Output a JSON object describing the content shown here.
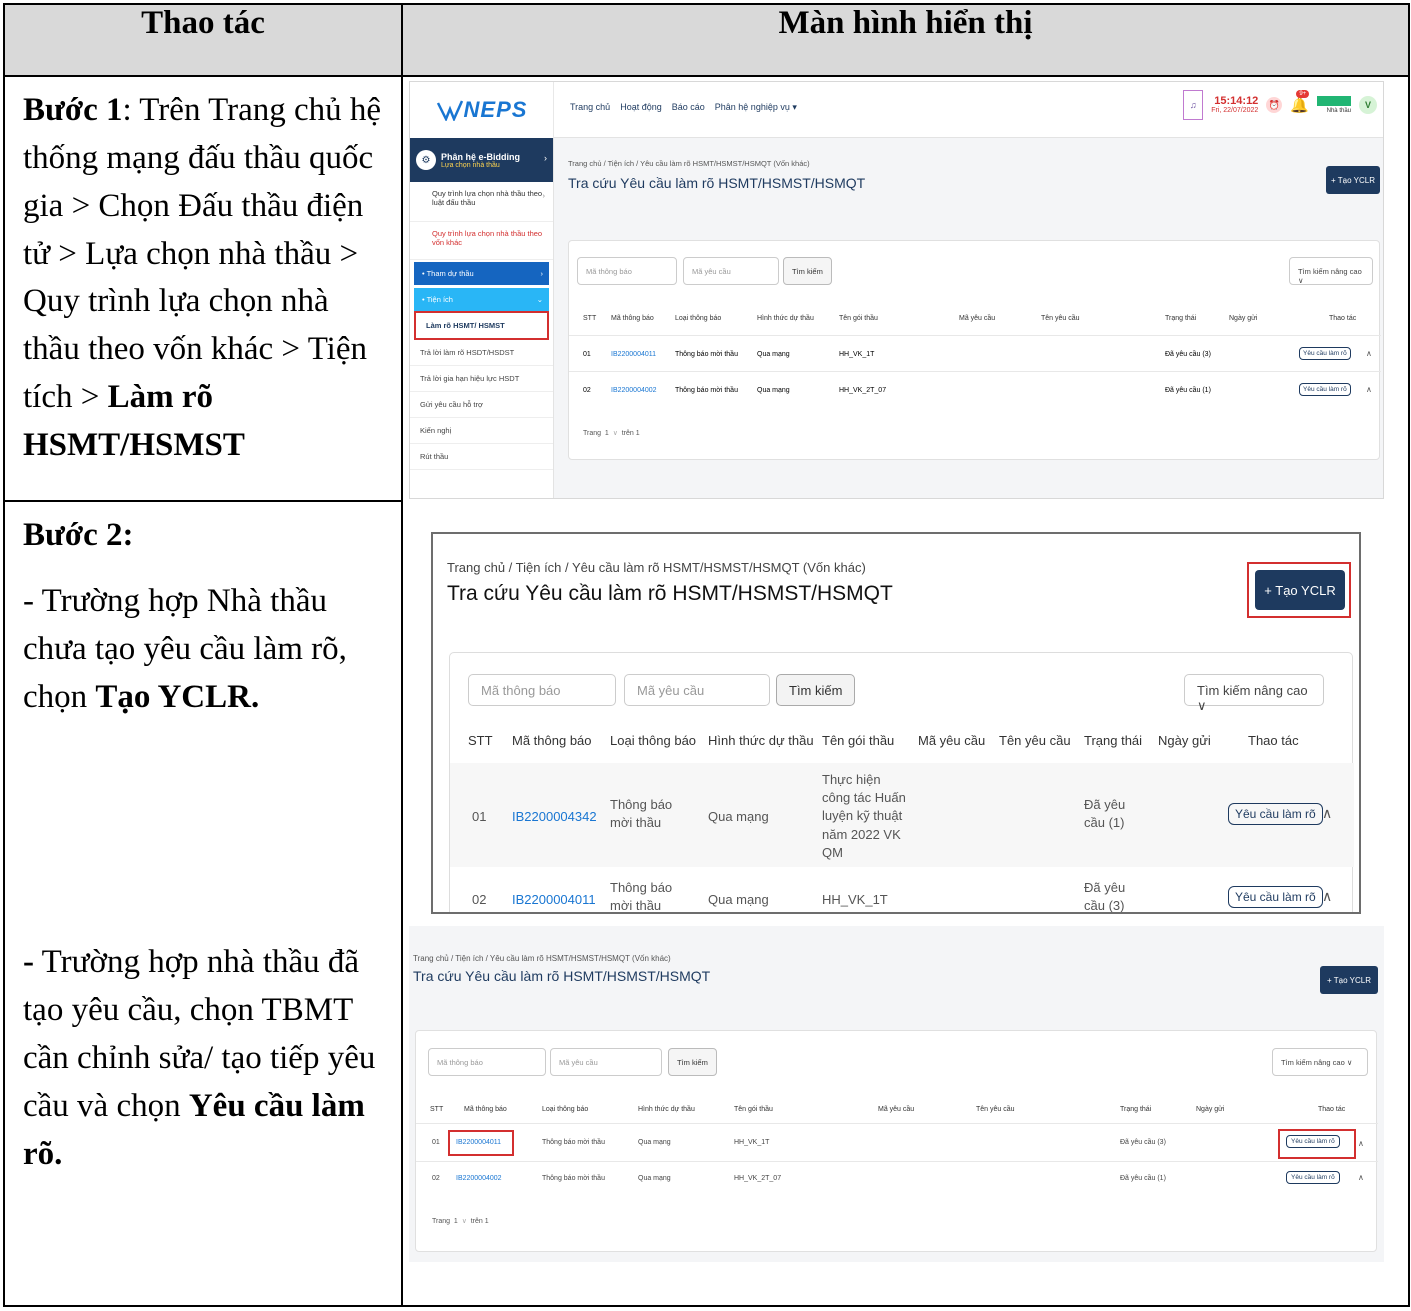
{
  "table": {
    "header_left": "Thao tác",
    "header_right": "Màn hình hiển thị"
  },
  "step1": {
    "label": "Bước 1",
    "text": ": Trên Trang chủ hệ thống mạng đấu thầu quốc gia > Chọn Đấu thầu điện tử > Lựa chọn nhà thầu > Quy trình lựa chọn nhà thầu theo vốn khác > Tiện tích > ",
    "bold_end": "Làm rõ HSMT/HSMST"
  },
  "step2": {
    "label": "Bước 2:",
    "case1_text": "- Trường hợp Nhà thầu chưa tạo yêu cầu làm rõ, chọn ",
    "case1_bold": "Tạo YCLR.",
    "case2_dash": "-",
    "case2_text": " Trường hợp nhà thầu đã tạo yêu cầu, chọn TBMT cần chỉnh sửa/ tạo tiếp yêu cầu và chọn ",
    "case2_bold": "Yêu cầu làm rõ."
  },
  "app": {
    "logo": "NEPS",
    "nav": [
      "Trang chủ",
      "Hoạt động",
      "Báo cáo",
      "Phân hệ nghiệp vụ ▾"
    ],
    "time": "15:14:12",
    "date": "Fri, 22/07/2022",
    "bell_badge": "9+",
    "user_role": "Nhà thầu",
    "avatar": "V",
    "sidebar": {
      "title": "Phân hệ e-Bidding",
      "subtitle": "Lựa chọn nhà thầu",
      "items": [
        "Quy trình lựa chọn nhà thầu theo luật đấu thầu",
        "Quy trình lựa chọn nhà thầu theo vốn khác"
      ],
      "group1": "Tham dự thầu",
      "group2": "Tiện ích",
      "subitems": [
        "Làm rõ HSMT/ HSMST",
        "Trả lời làm rõ HSDT/HSDST",
        "Trả lời gia hạn hiệu lực HSDT",
        "Gửi yêu cầu hỗ trợ",
        "Kiến nghị",
        "Rút thầu"
      ]
    }
  },
  "page": {
    "breadcrumb": "Trang chủ / Tiện ích / Yêu cầu làm rõ HSMT/HSMST/HSMQT (Vốn khác)",
    "title": "Tra cứu Yêu cầu làm rõ HSMT/HSMST/HSMQT",
    "create_button": "+ Tạo YCLR",
    "search_notice_placeholder": "Mã thông báo",
    "search_request_placeholder": "Mã yêu cầu",
    "search_button": "Tìm kiếm",
    "advanced_search": "Tìm kiếm nâng cao ∨",
    "columns": [
      "STT",
      "Mã thông báo",
      "Loại thông báo",
      "Hình thức dự thầu",
      "Tên gói thầu",
      "Mã yêu cầu",
      "Tên yêu cầu",
      "Trạng thái",
      "Ngày gửi",
      "Thao tác"
    ],
    "action_label": "Yêu cầu làm rõ",
    "pagination_prefix": "Trang",
    "pagination_page": "1",
    "pagination_suffix": "trên 1"
  },
  "rows_a": [
    {
      "stt": "01",
      "code": "IB2200004011",
      "type": "Thông báo mời thầu",
      "method": "Qua mạng",
      "package": "HH_VK_1T",
      "status": "Đã yêu cầu (3)"
    },
    {
      "stt": "02",
      "code": "IB2200004002",
      "type": "Thông báo mời thầu",
      "method": "Qua mạng",
      "package": "HH_VK_2T_07",
      "status": "Đã yêu cầu (1)"
    }
  ],
  "rows_b": [
    {
      "stt": "01",
      "code": "IB2200004342",
      "type": "Thông báo mời thầu",
      "method": "Qua mạng",
      "package": "Thực hiện công tác Huấn luyện kỹ thuật năm 2022 VK QM",
      "status": "Đã yêu cầu (1)"
    },
    {
      "stt": "02",
      "code": "IB2200004011",
      "type": "Thông báo mời thầu",
      "method": "Qua mạng",
      "package": "HH_VK_1T",
      "status": "Đã yêu cầu (3)"
    }
  ]
}
